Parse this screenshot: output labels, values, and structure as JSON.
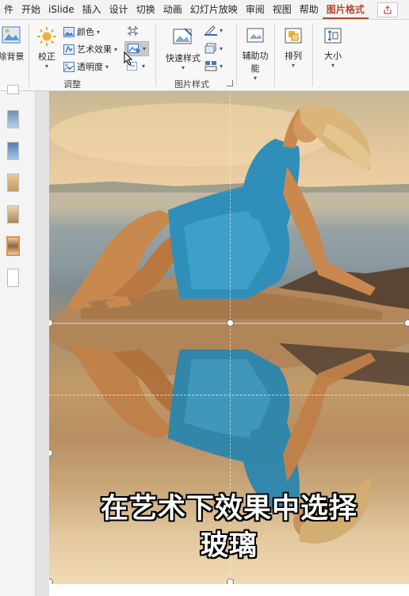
{
  "menubar": {
    "tabs": [
      "件",
      "开始",
      "iSlide",
      "插入",
      "设计",
      "切换",
      "动画",
      "幻灯片放映",
      "审阅",
      "视图",
      "帮助",
      "图片格式"
    ],
    "active_tab": "图片格式"
  },
  "ribbon": {
    "remove_bg_label": "除背景",
    "corrections_label": "校正",
    "color_label": "颜色",
    "artistic_label": "艺术效果",
    "transparency_label": "透明度",
    "adjust_group_label": "调整",
    "quick_styles_label": "快速样式",
    "picture_styles_group_label": "图片样式",
    "accessibility_label_1": "辅助功",
    "accessibility_label_2": "能",
    "arrange_label": "排列",
    "size_label": "大小"
  },
  "slide": {
    "caption_line1": "在艺术下效果中选择",
    "caption_line2": "玻璃"
  },
  "colors": {
    "accent": "#b7472a",
    "selected_thumb": "#e3913f",
    "dress": "#2f8fb8"
  }
}
